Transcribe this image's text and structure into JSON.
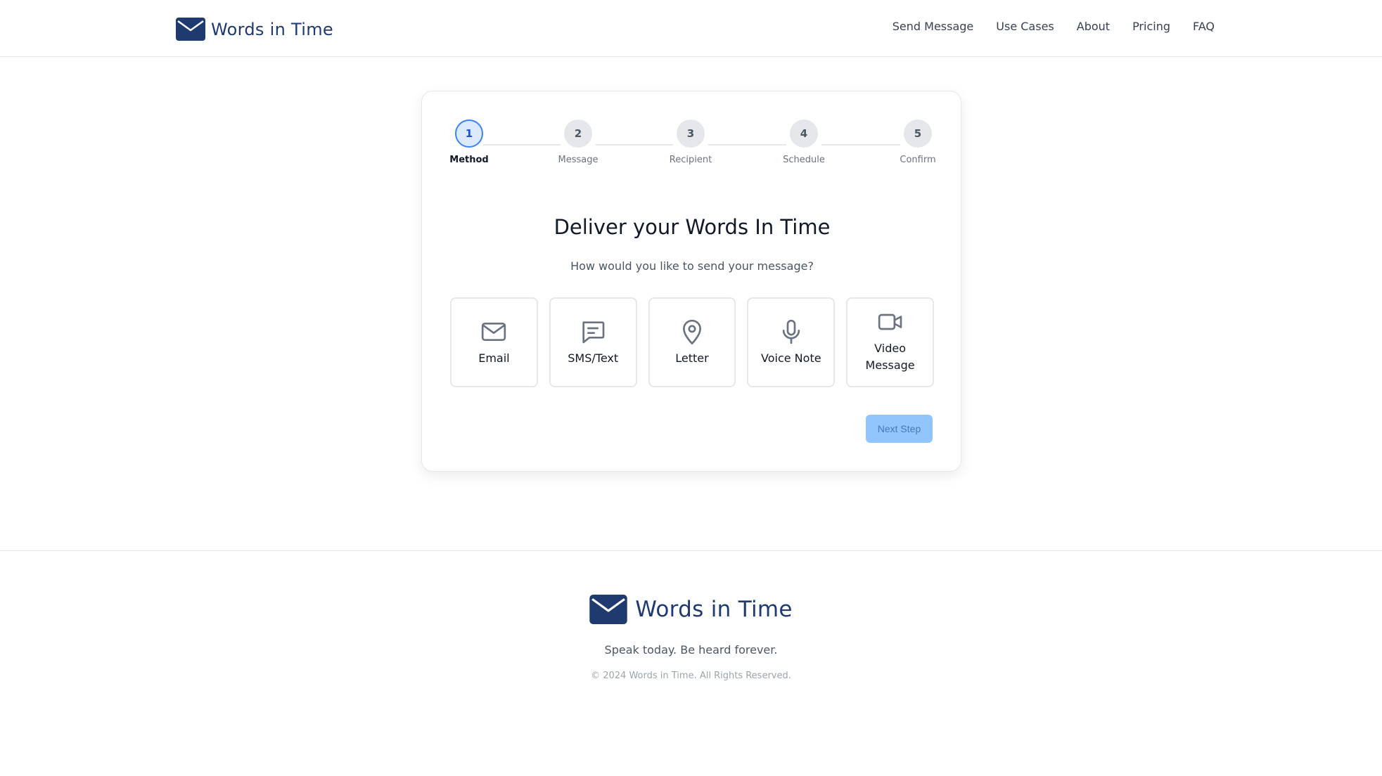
{
  "header": {
    "brand": "Words in Time",
    "nav": [
      "Send Message",
      "Use Cases",
      "About",
      "Pricing",
      "FAQ"
    ]
  },
  "stepper": {
    "steps": [
      {
        "number": "1",
        "label": "Method"
      },
      {
        "number": "2",
        "label": "Message"
      },
      {
        "number": "3",
        "label": "Recipient"
      },
      {
        "number": "4",
        "label": "Schedule"
      },
      {
        "number": "5",
        "label": "Confirm"
      }
    ],
    "active_step": 1
  },
  "main": {
    "title": "Deliver your Words In Time",
    "subtitle": "How would you like to send your message?",
    "methods": [
      {
        "label": "Email",
        "icon": "mail-icon"
      },
      {
        "label": "SMS/Text",
        "icon": "message-icon"
      },
      {
        "label": "Letter",
        "icon": "map-pin-icon"
      },
      {
        "label": "Voice Note",
        "icon": "microphone-icon"
      },
      {
        "label": "Video Message",
        "icon": "video-icon"
      }
    ],
    "next_label": "Next Step"
  },
  "footer": {
    "brand": "Words in Time",
    "tagline": "Speak today. Be heard forever.",
    "copyright": "© 2024 Words in Time. All Rights Reserved."
  },
  "colors": {
    "brand": "#1e3a6e",
    "accent": "#3b82f6",
    "button_disabled": "#93c5fd"
  }
}
